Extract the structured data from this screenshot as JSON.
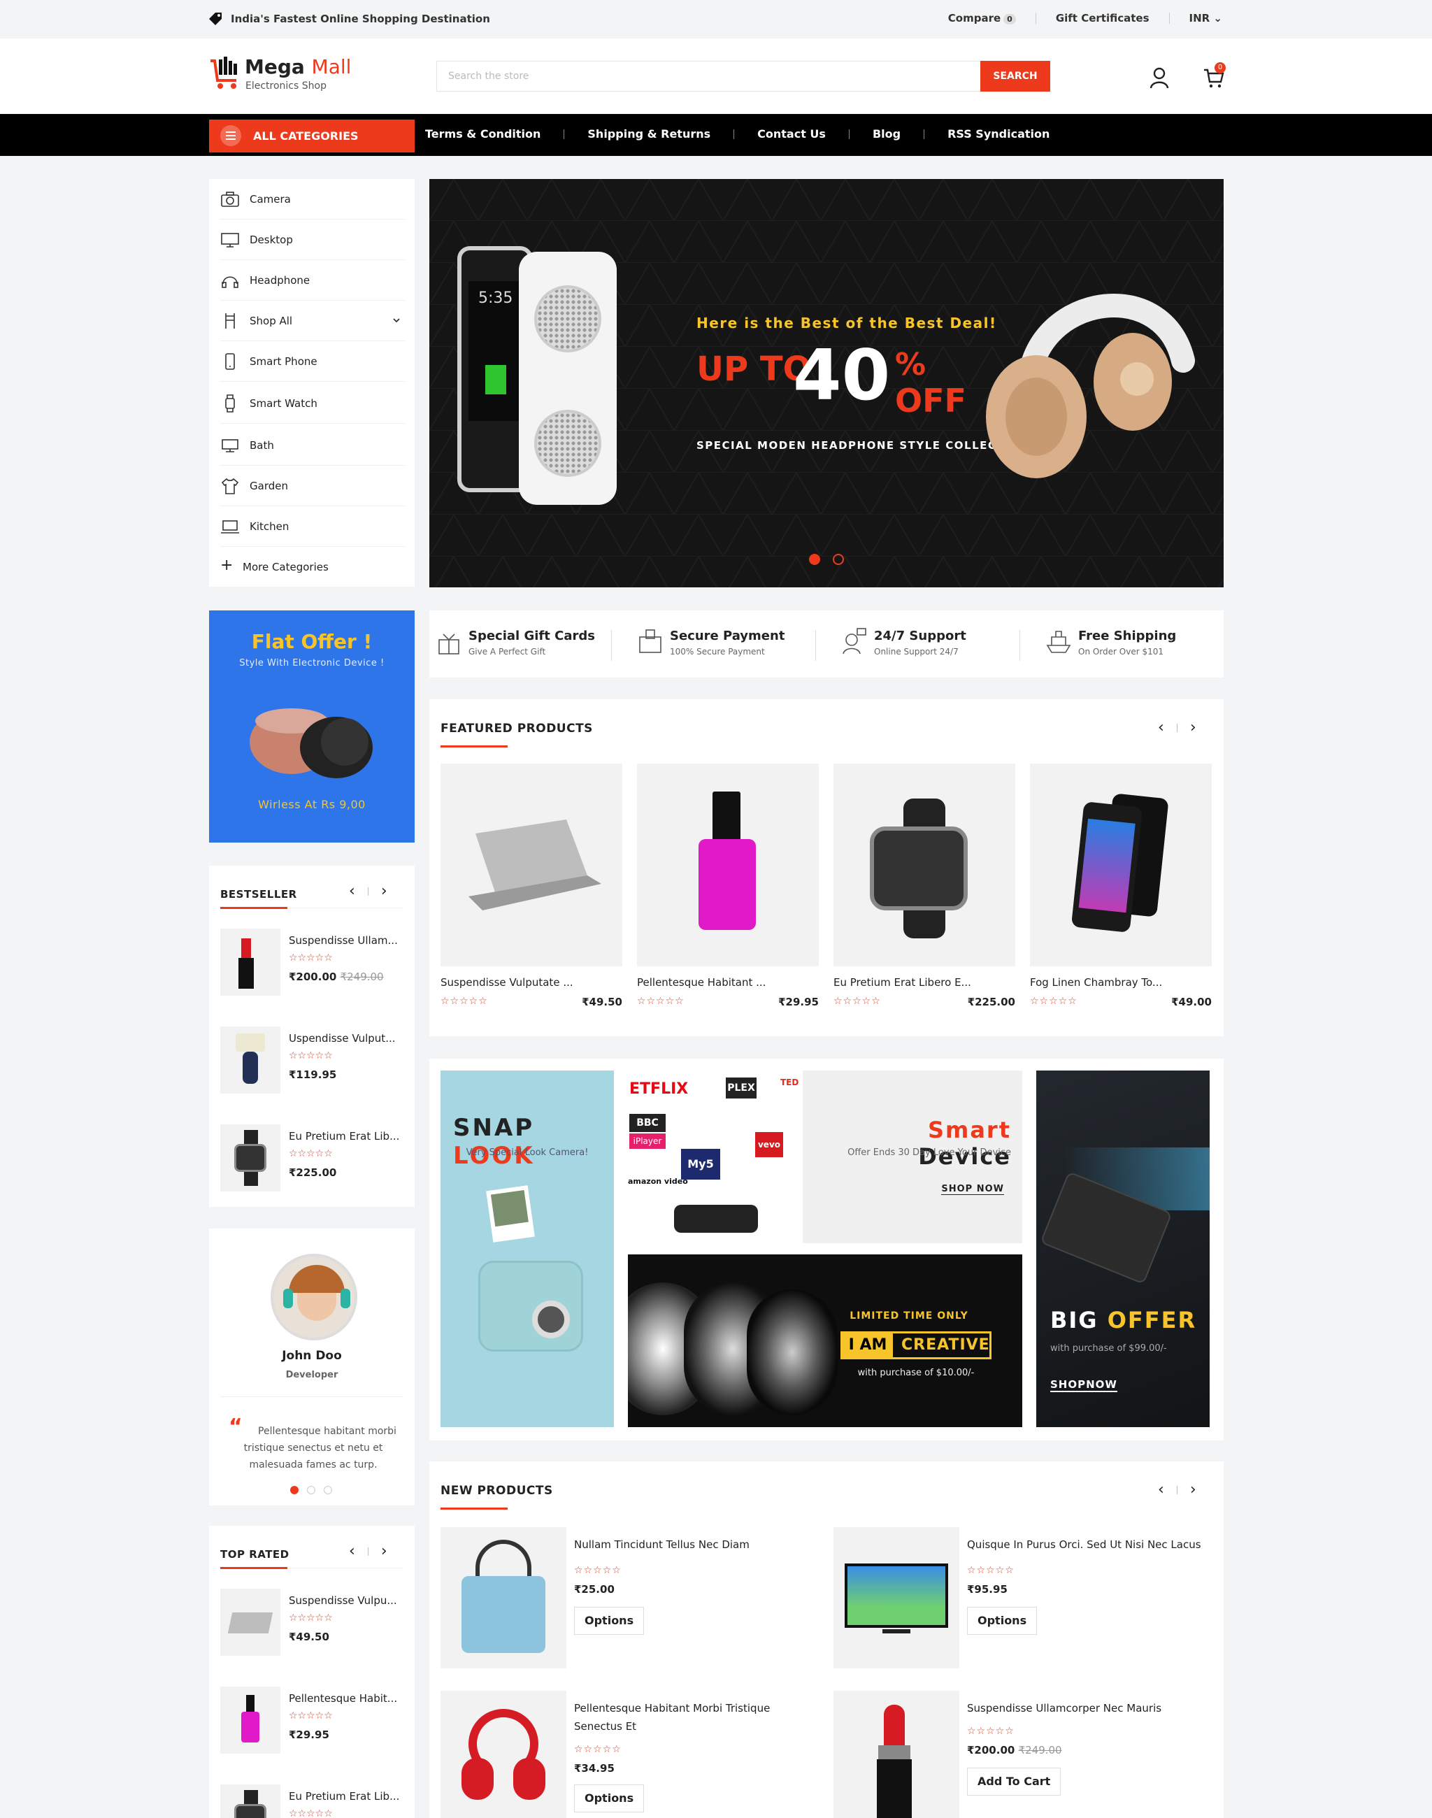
{
  "topbar": {
    "tagline": "India's Fastest Online Shopping Destination",
    "compare_label": "Compare",
    "compare_count": "0",
    "gift_label": "Gift Certificates",
    "currency": "INR"
  },
  "header": {
    "logo_main": "Mega",
    "logo_accent": "Mall",
    "logo_sub": "Electronics Shop",
    "search_placeholder": "Search the store",
    "search_button": "SEARCH",
    "cart_count": "0"
  },
  "nav": {
    "all_categories": "ALL CATEGORIES",
    "links": [
      "Terms & Condition",
      "Shipping & Returns",
      "Contact Us",
      "Blog",
      "RSS Syndication"
    ]
  },
  "categories": [
    {
      "label": "Camera",
      "icon": "camera-icon"
    },
    {
      "label": "Desktop",
      "icon": "monitor-icon"
    },
    {
      "label": "Headphone",
      "icon": "headphone-icon"
    },
    {
      "label": "Shop All",
      "icon": "chair-icon"
    },
    {
      "label": "Smart Phone",
      "icon": "phone-icon"
    },
    {
      "label": "Smart Watch",
      "icon": "watch-icon"
    },
    {
      "label": "Bath",
      "icon": "bath-icon"
    },
    {
      "label": "Garden",
      "icon": "shirt-icon"
    },
    {
      "label": "Kitchen",
      "icon": "laptop-icon"
    },
    {
      "label": "More Categories",
      "icon": "plus-icon"
    }
  ],
  "slider": {
    "kicker": "Here is the Best of the Best Deal!",
    "upto": "UP TO",
    "number": "40",
    "percent": "%",
    "off": "OFF",
    "subtitle": "SPECIAL MODEN HEADPHONE STYLE COLLECTION",
    "phone_time": "5:35"
  },
  "services": [
    {
      "title": "Special Gift Cards",
      "sub": "Give A Perfect Gift"
    },
    {
      "title": "Secure Payment",
      "sub": "100% Secure Payment"
    },
    {
      "title": "24/7 Support",
      "sub": "Online Support 24/7"
    },
    {
      "title": "Free Shipping",
      "sub": "On Order Over $101"
    }
  ],
  "flat_offer": {
    "title": "Flat Offer !",
    "sub": "Style With Electronic Device !",
    "price": "Wirless At Rs 9,00"
  },
  "featured": {
    "title": "FEATURED PRODUCTS",
    "products": [
      {
        "name": "Suspendisse Vulputate ...",
        "price": "₹49.50",
        "stars": "☆☆☆☆☆"
      },
      {
        "name": "Pellentesque Habitant ...",
        "price": "₹29.95",
        "stars": "☆☆☆☆☆"
      },
      {
        "name": "Eu Pretium Erat Libero E...",
        "price": "₹225.00",
        "stars": "☆☆☆☆☆"
      },
      {
        "name": "Fog Linen Chambray To...",
        "price": "₹49.00",
        "stars": "☆☆☆☆☆"
      }
    ]
  },
  "bestseller": {
    "title": "BESTSELLER",
    "items": [
      {
        "name": "Suspendisse Ullam...",
        "price": "₹200.00",
        "old": "₹249.00",
        "stars": "☆☆☆☆☆"
      },
      {
        "name": "Uspendisse Vulput...",
        "price": "₹119.95",
        "old": "",
        "stars": "☆☆☆☆☆"
      },
      {
        "name": "Eu Pretium Erat Lib...",
        "price": "₹225.00",
        "old": "",
        "stars": "☆☆☆☆☆"
      }
    ]
  },
  "testimonial": {
    "name": "John Doo",
    "role": "Developer",
    "quote": "Pellentesque habitant morbi tristique senectus et netu et malesuada fames ac turp."
  },
  "toprated": {
    "title": "TOP RATED",
    "items": [
      {
        "name": "Suspendisse Vulpu...",
        "price": "₹49.50",
        "stars": "☆☆☆☆☆"
      },
      {
        "name": "Pellentesque Habit...",
        "price": "₹29.95",
        "stars": "☆☆☆☆☆"
      },
      {
        "name": "Eu Pretium Erat Lib...",
        "price": "",
        "stars": "☆☆☆☆☆"
      }
    ]
  },
  "banners": {
    "snap_a": "SNAP",
    "snap_b": "LOOK",
    "snap_sub": "Very Special Look Camera!",
    "smart_a": "Smart",
    "smart_b": "Device",
    "smart_sub": "Offer Ends 30 Day Love Your Device",
    "smart_cta": "SHOP NOW",
    "streams": [
      "ETFLIX",
      "PLEX",
      "TED",
      "BBC",
      "iPlayer",
      "My5",
      "vevo",
      "amazon video"
    ],
    "limited": "LIMITED TIME ONLY",
    "iam": "I AM",
    "creative": "CREATIVE",
    "limited_sub": "with purchase of $10.00/-",
    "big_a": "BIG",
    "big_b": "OFFER",
    "big_sub": "with purchase of $99.00/-",
    "big_cta": "SHOPNOW"
  },
  "newproducts": {
    "title": "NEW PRODUCTS",
    "items": [
      {
        "name": "Nullam Tincidunt Tellus Nec Diam",
        "price": "₹25.00",
        "old": "",
        "button": "Options",
        "stars": "☆☆☆☆☆"
      },
      {
        "name": "Quisque In Purus Orci. Sed Ut Nisi Nec Lacus",
        "price": "₹95.95",
        "old": "",
        "button": "Options",
        "stars": "☆☆☆☆☆"
      },
      {
        "name": "Pellentesque Habitant Morbi Tristique Senectus Et",
        "price": "₹34.95",
        "old": "",
        "button": "Options",
        "stars": "☆☆☆☆☆"
      },
      {
        "name": "Suspendisse Ullamcorper Nec Mauris",
        "price": "₹200.00",
        "old": "₹249.00",
        "button": "Add To Cart",
        "stars": "☆☆☆☆☆"
      }
    ]
  },
  "colors": {
    "accent": "#ee3a1c",
    "nav": "#000000",
    "offer_blue": "#2d75e8",
    "page_bg": "#f2f4f5"
  }
}
